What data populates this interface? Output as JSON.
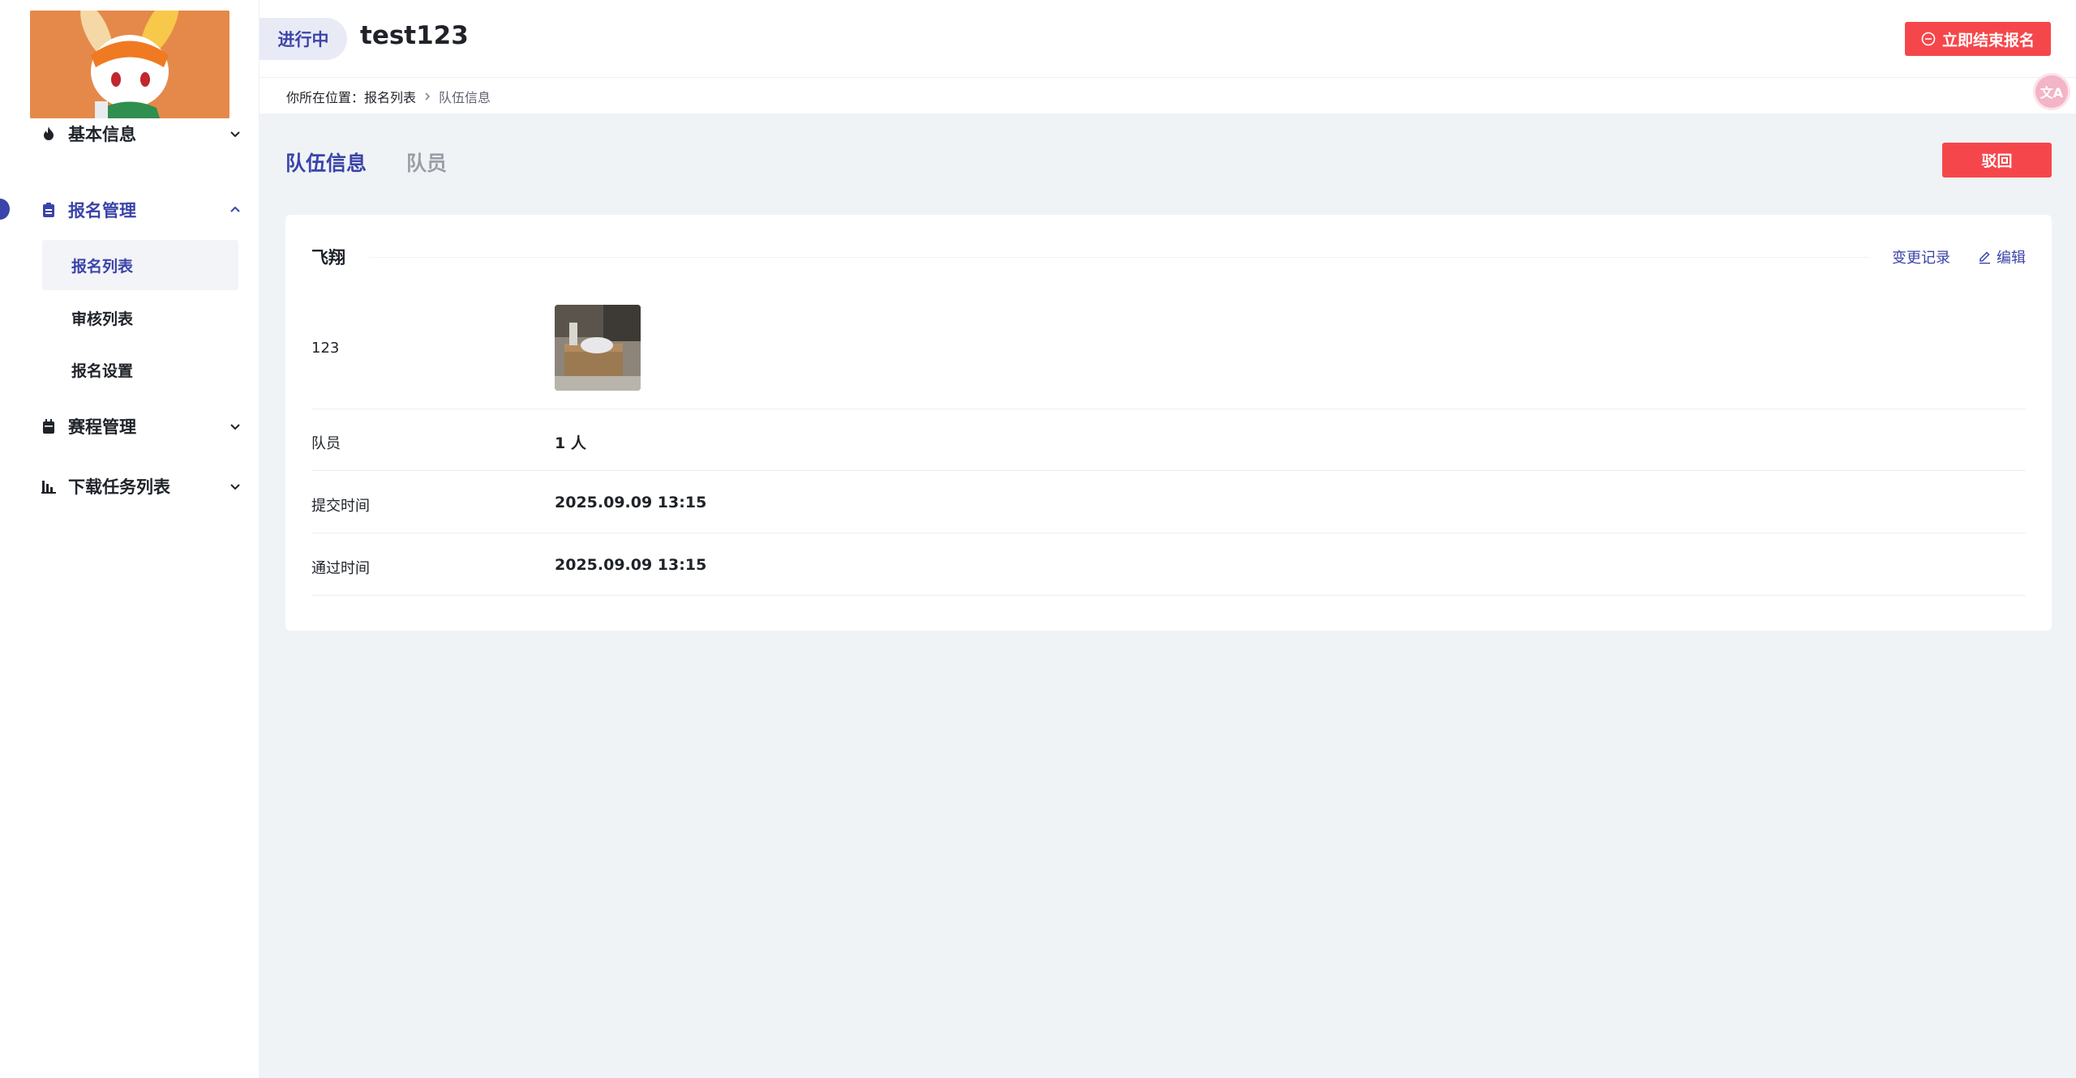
{
  "sidebar": {
    "logo_alt": "rabbit character avatar",
    "groups": [
      {
        "label": "基本信息",
        "icon": "fire-icon",
        "expanded": false
      },
      {
        "label": "报名管理",
        "icon": "clipboard-icon",
        "expanded": true
      },
      {
        "label": "赛程管理",
        "icon": "calendar-icon",
        "expanded": false
      },
      {
        "label": "下载任务列表",
        "icon": "bar-chart-icon",
        "expanded": false
      }
    ],
    "sub_items": [
      {
        "label": "报名列表",
        "active": true
      },
      {
        "label": "审核列表",
        "active": false
      },
      {
        "label": "报名设置",
        "active": false
      }
    ]
  },
  "header": {
    "status": "进行中",
    "title": "test123",
    "end_button": "立即结束报名"
  },
  "breadcrumb": {
    "prefix": "你所在位置：",
    "link": "报名列表",
    "current": "队伍信息"
  },
  "translate_fab": {
    "label": "文A",
    "icon": "translate-icon"
  },
  "tabs": [
    {
      "label": "队伍信息",
      "active": true
    },
    {
      "label": "队员",
      "active": false
    }
  ],
  "reject_button": "驳回",
  "card": {
    "team_name": "飞翔",
    "history_label": "变更记录",
    "edit_label": "编辑",
    "rows": [
      {
        "label": "123",
        "type": "image"
      },
      {
        "label": "队员",
        "value": "1 人"
      },
      {
        "label": "提交时间",
        "value": "2025.09.09 13:15"
      },
      {
        "label": "通过时间",
        "value": "2025.09.09 13:15"
      }
    ]
  },
  "colors": {
    "primary": "#3b44a8",
    "danger": "#f5474b",
    "background": "#f0f3f6",
    "logo_bg": "#e5894a"
  }
}
